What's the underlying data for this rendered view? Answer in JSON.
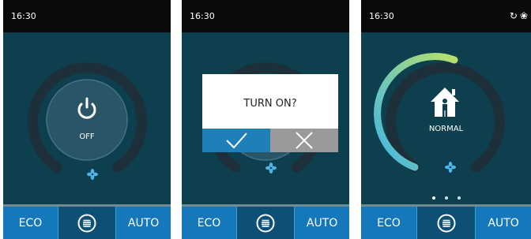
{
  "colors": {
    "screen_bg": "#0d3f4e",
    "status_bar": "#0a0a0a",
    "bottom_bar": "#1478ba",
    "bottom_bar_selected": "#0e4f76",
    "dial_ring": "#1d2f39",
    "dial_knob": "#2a5566",
    "confirm": "#1f7fb8",
    "cancel": "#9a9a9a",
    "arc_start": "#3fb6e6",
    "arc_end": "#b8e06a"
  },
  "screens": [
    {
      "status": {
        "time": "16:30"
      },
      "dial": {
        "power_icon": "power-icon",
        "label": "OFF",
        "fan_icon": "fan-icon"
      },
      "bottom": {
        "left": "ECO",
        "middle_icon": "menu-icon",
        "right": "AUTO"
      }
    },
    {
      "status": {
        "time": "16:30"
      },
      "dialog": {
        "title": "TURN ON?",
        "confirm_icon": "checkmark-icon",
        "cancel_icon": "x-icon"
      },
      "bottom": {
        "left": "ECO",
        "middle_icon": "menu-icon",
        "right": "AUTO"
      }
    },
    {
      "status": {
        "time": "16:30",
        "icons": [
          "sync-icon",
          "fan-icon"
        ]
      },
      "dial": {
        "mode_icon": "home-person-icon",
        "label": "NORMAL",
        "fan_icon": "fan-icon"
      },
      "pager": {
        "pages": 3,
        "active": 0
      },
      "bottom": {
        "left": "ECO",
        "middle_icon": "menu-icon",
        "right": "AUTO"
      }
    }
  ]
}
